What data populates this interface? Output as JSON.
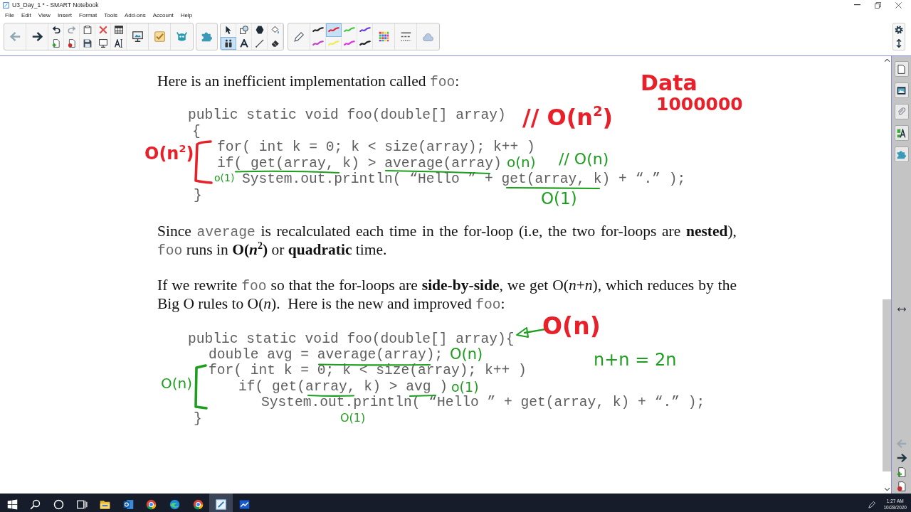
{
  "window": {
    "title": "U3_Day_1 * - SMART Notebook"
  },
  "menu": [
    "File",
    "Edit",
    "View",
    "Insert",
    "Format",
    "Tools",
    "Add-ons",
    "Account",
    "Help"
  ],
  "toolbar": {
    "tools": [
      {
        "kind": "select",
        "selected": false
      },
      {
        "kind": "shape",
        "selected": false
      },
      {
        "kind": "polygon",
        "selected": false
      },
      {
        "kind": "fill",
        "selected": false
      },
      {
        "kind": "multitouch",
        "selected": true
      },
      {
        "kind": "text",
        "selected": false
      },
      {
        "kind": "line",
        "selected": false
      },
      {
        "kind": "eraser",
        "selected": false
      }
    ],
    "pens": [
      {
        "color": "#262626",
        "selected": false
      },
      {
        "color": "#e0283a",
        "selected": true
      },
      {
        "color": "#46c846",
        "selected": false
      },
      {
        "color": "#6a40d8",
        "selected": false
      },
      {
        "color": "#c040c8",
        "selected": false
      },
      {
        "color": "#eeee48",
        "selected": false
      },
      {
        "color": "#e030e0",
        "selected": false
      },
      {
        "color": "#1c1c1c",
        "selected": false
      }
    ]
  },
  "page": {
    "intro": [
      {
        "kind": "text",
        "text": "Here is an inefficient implementation called "
      },
      {
        "kind": "code",
        "text": "foo"
      },
      {
        "kind": "text",
        "text": ":"
      }
    ],
    "code_1": [
      "public static void foo(double[] array)",
      "{",
      "for( int k = 0; k < size(array); k++ )",
      "if( get(array, k) > average(array)",
      "System.out.println( “Hello ” + get(array, k) + “.” );",
      "}"
    ],
    "paragraphs": [
      [
        {
          "kind": "text",
          "text": "Since "
        },
        {
          "kind": "code",
          "text": "average"
        },
        {
          "kind": "text",
          "text": " is recalculated each time in the for-loop (i.e, the two for-loops are **nested**), "
        },
        {
          "kind": "code",
          "text": "foo"
        },
        {
          "kind": "text",
          "text": " runs in **O(*n*$^{2}$)** or **quadratic** time."
        }
      ],
      [
        {
          "kind": "text",
          "text": "If we rewrite "
        },
        {
          "kind": "code",
          "text": "foo"
        },
        {
          "kind": "text",
          "text": " so that the for-loops are **side-by-side**, we get O(*n*+*n*), which reduces by the Big O rules to O(*n*).  Here is the new and improved "
        },
        {
          "kind": "code",
          "text": "foo"
        },
        {
          "kind": "text",
          "text": ":"
        }
      ]
    ],
    "code_2": [
      "public static void foo(double[] array){",
      "double avg = average(array);",
      "for( int k = 0; k < size(array); k++ )",
      "if( get(array, k) > avg )",
      "System.out.println( “Hello ” + get(array, k) + “.” );",
      "}"
    ]
  },
  "ink": [
    {
      "kind": "text",
      "text": "Data",
      "color": "#e8202a"
    },
    {
      "kind": "text",
      "text": "1000000",
      "color": "#e8202a"
    },
    {
      "kind": "text",
      "text": "// O(n$^{2}$)",
      "color": "#e8202a"
    },
    {
      "kind": "text",
      "text": "O(n$^{2}$)",
      "color": "#e8202a"
    },
    {
      "kind": "bracket",
      "color": "#e8202a"
    },
    {
      "kind": "text",
      "text": "o(1)",
      "color": "#1e9e1e"
    },
    {
      "kind": "underline",
      "color": "#1e9e1e"
    },
    {
      "kind": "underline",
      "color": "#1e9e1e"
    },
    {
      "kind": "text",
      "text": "o(n)",
      "color": "#1e9e1e"
    },
    {
      "kind": "text",
      "text": "// O(n)",
      "color": "#1e9e1e"
    },
    {
      "kind": "underline",
      "color": "#1e9e1e"
    },
    {
      "kind": "text",
      "text": "O(1)",
      "color": "#1e9e1e"
    },
    {
      "kind": "arrow",
      "color": "#1e9e1e"
    },
    {
      "kind": "text",
      "text": "O(n)",
      "color": "#e8202a"
    },
    {
      "kind": "underline",
      "color": "#1e9e1e"
    },
    {
      "kind": "text",
      "text": "O(n)",
      "color": "#1e9e1e"
    },
    {
      "kind": "text",
      "text": "n+n = 2n",
      "color": "#1e9e1e"
    },
    {
      "kind": "text",
      "text": "O(n)",
      "color": "#1e9e1e"
    },
    {
      "kind": "bracket",
      "color": "#1e9e1e"
    },
    {
      "kind": "underline",
      "color": "#1e9e1e"
    },
    {
      "kind": "text",
      "text": "O(1)",
      "color": "#1e9e1e"
    },
    {
      "kind": "underline",
      "color": "#1e9e1e"
    },
    {
      "kind": "text",
      "text": "o(1)",
      "color": "#1e9e1e"
    }
  ],
  "taskbar": {
    "apps": [
      {
        "kind": "folder",
        "selected": false
      },
      {
        "kind": "mail",
        "selected": false
      },
      {
        "kind": "browser",
        "selected": false
      },
      {
        "kind": "web",
        "selected": false
      },
      {
        "kind": "browser",
        "selected": false
      },
      {
        "kind": "notebook",
        "selected": true
      },
      {
        "kind": "chart",
        "selected": false
      }
    ],
    "time": "1:27 AM",
    "date": "10/28/2020"
  }
}
